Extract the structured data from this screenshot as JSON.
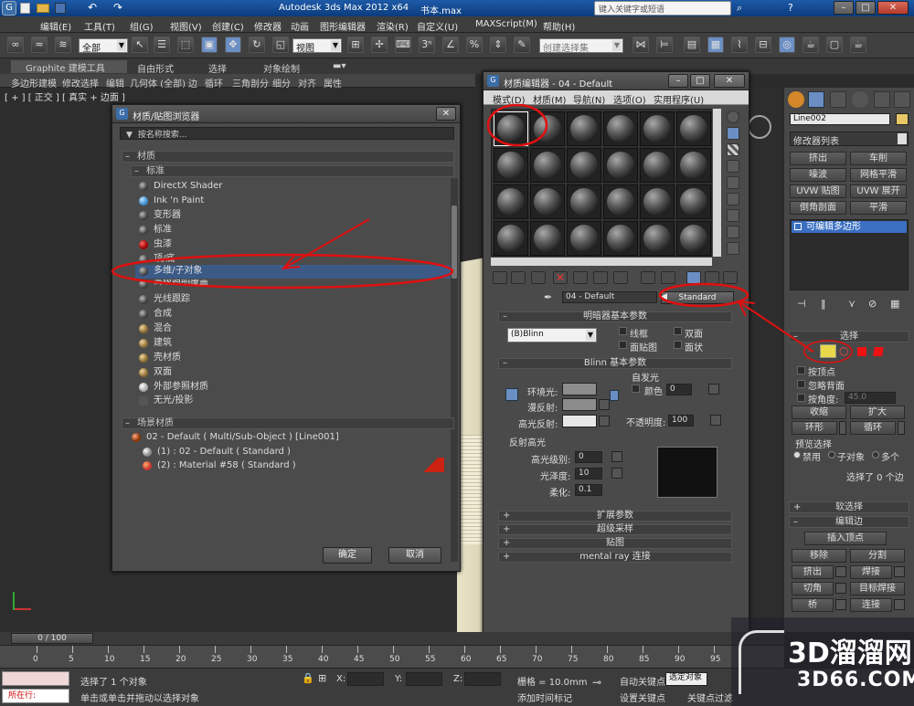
{
  "app": {
    "title": "Autodesk 3ds Max  2012 x64",
    "file": "书本.max",
    "search_placeholder": "键入关键字或短语"
  },
  "menu": [
    "编辑(E)",
    "工具(T)",
    "组(G)",
    "视图(V)",
    "创建(C)",
    "修改器",
    "动画",
    "图形编辑器",
    "渲染(R)",
    "自定义(U)",
    "MAXScript(M)",
    "帮助(H)"
  ],
  "toolbar": {
    "filter": "全部",
    "ref_coord": "视图",
    "named_sel": "创建选择集"
  },
  "ribbon": {
    "tabs": [
      "Graphite 建模工具",
      "自由形式",
      "选择",
      "对象绘制"
    ],
    "subtabs": [
      "多边形建模",
      "修改选择",
      "编辑",
      "几何体 (全部)",
      "边",
      "循环",
      "三角剖分",
      "细分",
      "对齐",
      "属性"
    ]
  },
  "viewport": {
    "label": "[ + ] [ 正交 ] [ 真实 + 边面 ]"
  },
  "mat_browser": {
    "title": "材质/贴图浏览器",
    "search": "按名称搜索...",
    "sec_materials": "材质",
    "sec_standard": "标准",
    "items": [
      "DirectX Shader",
      "Ink 'n Paint",
      "变形器",
      "标准",
      "虫漆",
      "顶/底",
      "多维/子对象",
      "高级照明覆盖",
      "光线跟踪",
      "合成",
      "混合",
      "建筑",
      "壳材质",
      "双面",
      "外部参照材质",
      "无光/投影"
    ],
    "sec_scene": "场景材质",
    "scene_items": [
      "02 - Default ( Multi/Sub-Object ) [Line001]",
      "(1) : 02 - Default ( Standard )",
      "(2) : Material #58 ( Standard )"
    ],
    "ok": "确定",
    "cancel": "取消"
  },
  "mat_editor": {
    "title": "材质编辑器 - 04 - Default",
    "menu": [
      "模式(D)",
      "材质(M)",
      "导航(N)",
      "选项(O)",
      "实用程序(U)"
    ],
    "mat_name": "04 - Default",
    "mat_type": "Standard",
    "shader_rollout": "明暗器基本参数",
    "shader": "(B)Blinn",
    "wire": "线框",
    "two_sided": "双面",
    "face_map": "面贴图",
    "faceted": "面状",
    "blinn_rollout": "Blinn 基本参数",
    "self_illum": "自发光",
    "color": "颜色",
    "color_val": "0",
    "ambient": "环境光:",
    "diffuse": "漫反射:",
    "specular": "高光反射:",
    "opacity": "不透明度:",
    "opacity_val": "100",
    "spec_highlights": "反射高光",
    "spec_level": "高光级别:",
    "spec_level_val": "0",
    "gloss": "光泽度:",
    "gloss_val": "10",
    "soften": "柔化:",
    "soften_val": "0.1",
    "rollouts": [
      "扩展参数",
      "超级采样",
      "贴图",
      "mental ray 连接"
    ]
  },
  "cmd": {
    "obj_name": "Line002",
    "mod_list": "修改器列表",
    "buttons": [
      "挤出",
      "车削",
      "噪波",
      "网格平滑",
      "UVW 贴图",
      "UVW 展开",
      "倒角剖面",
      "平滑"
    ],
    "stack_item": "可编辑多边形",
    "sel_title": "选择",
    "by_vertex": "按顶点",
    "ignore_back": "忽略背面",
    "by_angle": "按角度:",
    "angle_val": "45.0",
    "shrink": "收缩",
    "grow": "扩大",
    "ring": "环形",
    "loop": "循环",
    "preview": "预览选择",
    "disabled": "禁用",
    "subobj": "子对象",
    "multi": "多个",
    "selected": "选择了 0 个边",
    "soft_sel": "软选择",
    "edit_edges": "编辑边",
    "insert_vertex": "插入顶点",
    "remove": "移除",
    "split": "分割",
    "extrude": "挤出",
    "weld": "焊接",
    "chamfer": "切角",
    "target_weld": "目标焊接",
    "bridge": "桥",
    "connect": "连接"
  },
  "bottom": {
    "frame": "0 / 100",
    "ticks": [
      "0",
      "5",
      "10",
      "15",
      "20",
      "25",
      "30",
      "35",
      "40",
      "45",
      "50",
      "55",
      "60",
      "65",
      "70",
      "75",
      "80",
      "85",
      "90",
      "95"
    ],
    "status1": "选择了 1 个对象",
    "status2": "单击或单击并拖动以选择对象",
    "x": "X:",
    "y": "Y:",
    "z": "Z:",
    "grid": "栅格 = 10.0mm",
    "auto_key": "自动关键点",
    "sel_obj": "选定对象",
    "set_key": "设置关键点",
    "key_filter": "关键点过滤",
    "add_time": "添加时间标记",
    "running": "所在行:"
  },
  "watermark": {
    "brand": "3D溜溜网",
    "url": "3D66.COM"
  }
}
